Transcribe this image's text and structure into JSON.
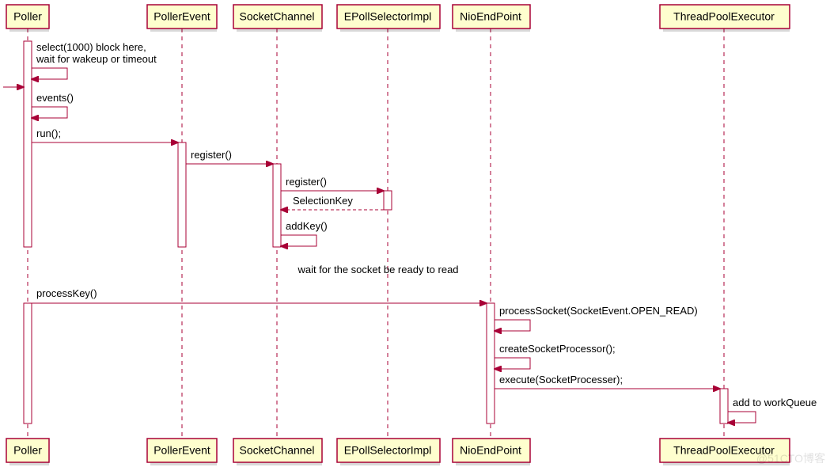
{
  "participants": {
    "poller": "Poller",
    "pollerEvent": "PollerEvent",
    "socketChannel": "SocketChannel",
    "epollSelector": "EPollSelectorImpl",
    "nioEndPoint": "NioEndPoint",
    "threadPoolExecutor": "ThreadPoolExecutor"
  },
  "messages": {
    "m1a": "select(1000) block here,",
    "m1b": "wait for wakeup or timeout",
    "m2": "events()",
    "m3": "run();",
    "m4": "register()",
    "m5": "register()",
    "m6": "SelectionKey",
    "m7": "addKey()",
    "note1": "wait for the socket be ready to read",
    "m8": "processKey()",
    "m9": "processSocket(SocketEvent.OPEN_READ)",
    "m10": "createSocketProcessor();",
    "m11": "execute(SocketProcesser);",
    "m12": "add to workQueue"
  },
  "watermark": "@51CTO博客"
}
